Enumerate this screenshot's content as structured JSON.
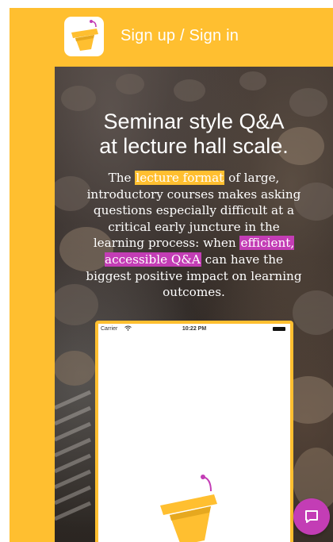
{
  "header": {
    "signin_label": "Sign up / Sign in",
    "logo_icon": "bucket-logo-icon"
  },
  "hero": {
    "title_line1": "Seminar style Q&A",
    "title_line2": "at lecture hall scale.",
    "body_pre": "The ",
    "body_highlight1": "lecture format",
    "body_mid": " of large, introductory courses makes asking questions especially difficult at a critical early juncture in the learning process: when ",
    "body_highlight2": "efficient, accessible Q&A",
    "body_post": " can have the biggest positive impact on learning outcomes."
  },
  "phone": {
    "carrier": "Carrier",
    "time": "10:22 PM",
    "wifi_icon": "wifi-icon",
    "battery_icon": "battery-icon"
  },
  "chat": {
    "icon": "chat-bubble-icon"
  },
  "colors": {
    "brand_yellow": "#FFBF30",
    "accent_pink": "#C33DB5",
    "text_white": "#FFFFFF"
  }
}
